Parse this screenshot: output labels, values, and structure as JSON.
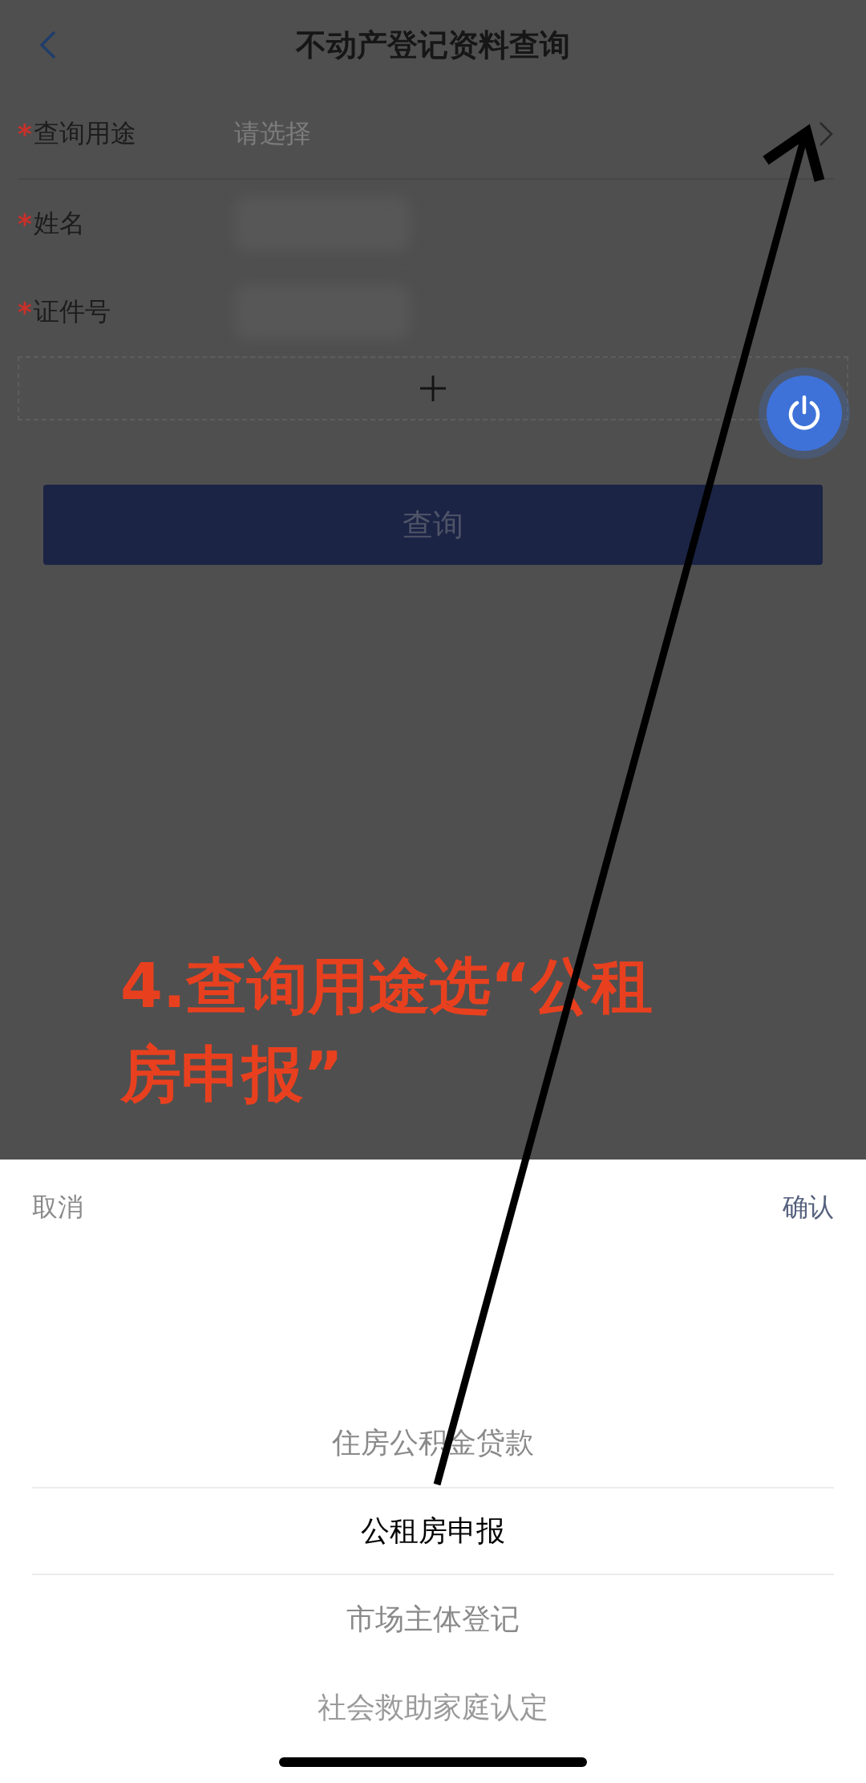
{
  "header": {
    "title": "不动产登记资料查询"
  },
  "form": {
    "fields": [
      {
        "mark": "*",
        "label": "查询用途",
        "kind": "select",
        "placeholder": "请选择"
      },
      {
        "mark": "*",
        "label": "姓名",
        "kind": "text"
      },
      {
        "mark": "*",
        "label": "证件号",
        "kind": "text"
      }
    ],
    "submit": "查询"
  },
  "annotation": {
    "text": "4.查询用途选“公租房申报”"
  },
  "picker": {
    "cancel": "取消",
    "confirm": "确认",
    "options": [
      {
        "label": "住房公积金贷款",
        "selected": false
      },
      {
        "label": "公租房申报",
        "selected": true
      },
      {
        "label": "市场主体登记",
        "selected": false
      },
      {
        "label": "社会救助家庭认定",
        "selected": false
      }
    ]
  }
}
